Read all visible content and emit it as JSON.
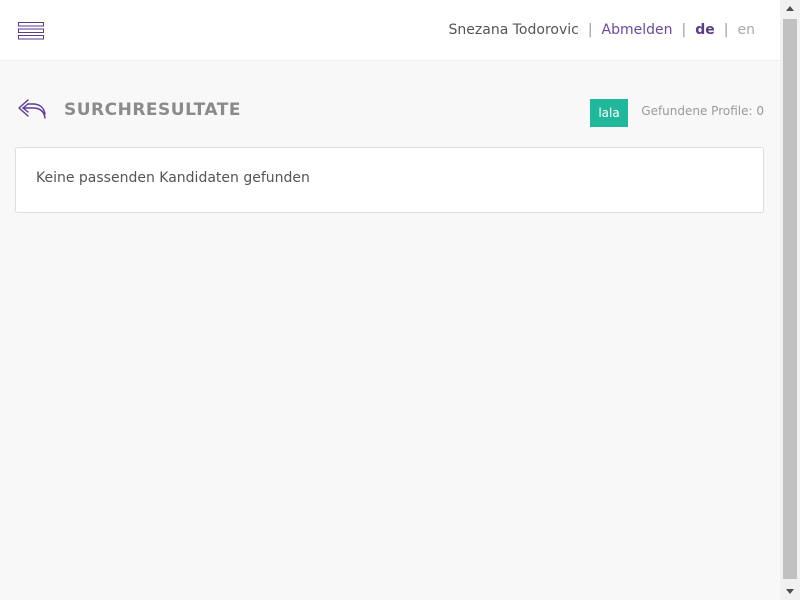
{
  "header": {
    "user_name": "Snezana Todorovic",
    "separator": "|",
    "logout_label": "Abmelden",
    "languages": {
      "active": "de",
      "inactive": "en"
    },
    "menu_icon": "hamburger-icon"
  },
  "search": {
    "back_icon": "back-arrow-icon",
    "title": "SURCHRESULTATE",
    "tag_label": "lala",
    "found_label": "Gefundene Profile: 0",
    "empty_message": "Keine passenden Kandidaten gefunden"
  },
  "colors": {
    "accent_purple": "#5b3a8f",
    "tag_green": "#1fb89a",
    "background": "#f8f8f8"
  }
}
